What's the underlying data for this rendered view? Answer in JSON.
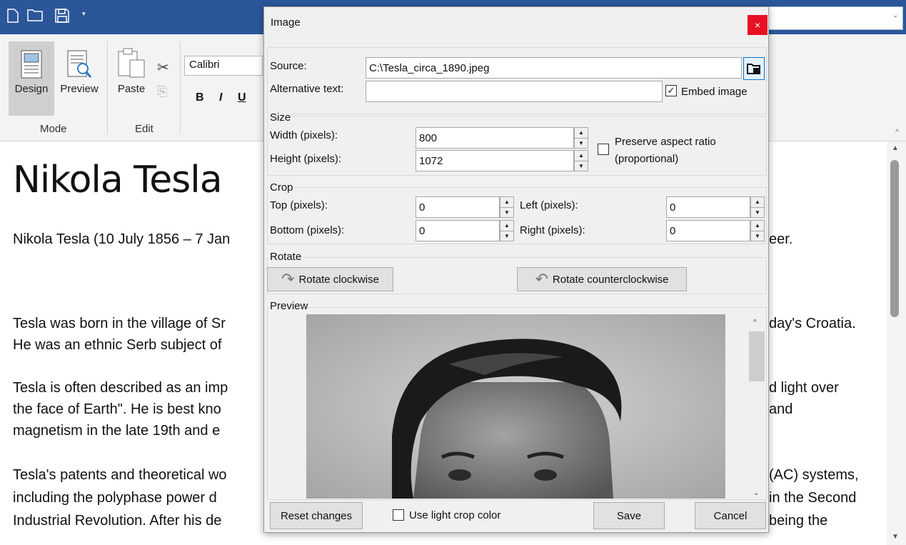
{
  "quick_access": {
    "new_icon": "new-document-icon",
    "open_icon": "open-folder-icon",
    "save_icon": "save-icon",
    "customize_icon": "dropdown-caret-icon"
  },
  "ribbon": {
    "mode_group_label": "Mode",
    "edit_group_label": "Edit",
    "design_label": "Design",
    "preview_label": "Preview",
    "paste_label": "Paste",
    "font_name": "Calibri",
    "bold": "B",
    "italic": "I",
    "underline": "U"
  },
  "document": {
    "heading": "Nikola Tesla",
    "lines": [
      {
        "left": "Nikola Tesla (10 July 1856 – 7 Jan",
        "right": "eer."
      },
      {
        "left": "Tesla was born in the village of Sr",
        "right": "day's Croatia."
      },
      {
        "left": "He was an ethnic Serb subject of",
        "right": ""
      },
      {
        "left": "Tesla is often described as an imp",
        "right": "d light over"
      },
      {
        "left": "the face of Earth\". He is best kno",
        "right": "and"
      },
      {
        "left": "magnetism in the late 19th and e",
        "right": ""
      },
      {
        "left": "Tesla's patents and theoretical wo",
        "right": "(AC) systems,"
      },
      {
        "left": "including the polyphase power d",
        "right": "in the Second"
      },
      {
        "left": "Industrial Revolution. After his de",
        "right": "being the"
      }
    ]
  },
  "dialog": {
    "title": "Image",
    "close_symbol": "×",
    "source_label": "Source:",
    "source_value": "C:\\Tesla_circa_1890.jpeg",
    "alt_text_label": "Alternative text:",
    "alt_text_value": "",
    "embed_image_label": "Embed image",
    "embed_image_checked": true,
    "size_legend": "Size",
    "width_label": "Width (pixels):",
    "width_value": "800",
    "height_label": "Height (pixels):",
    "height_value": "1072",
    "preserve_aspect_label_1": "Preserve aspect ratio",
    "preserve_aspect_label_2": "(proportional)",
    "preserve_aspect_checked": false,
    "crop_legend": "Crop",
    "top_label": "Top (pixels):",
    "top_value": "0",
    "bottom_label": "Bottom (pixels):",
    "bottom_value": "0",
    "left_label": "Left (pixels):",
    "left_value": "0",
    "right_label": "Right (pixels):",
    "right_value": "0",
    "rotate_legend": "Rotate",
    "rotate_cw_label": "Rotate clockwise",
    "rotate_ccw_label": "Rotate counterclockwise",
    "preview_legend": "Preview",
    "reset_label": "Reset changes",
    "light_crop_label": "Use light crop color",
    "light_crop_checked": false,
    "save_label": "Save",
    "cancel_label": "Cancel"
  },
  "colors": {
    "title_bar": "#2b579a",
    "close_button": "#e81123",
    "dialog_bg": "#f0f0f0"
  }
}
